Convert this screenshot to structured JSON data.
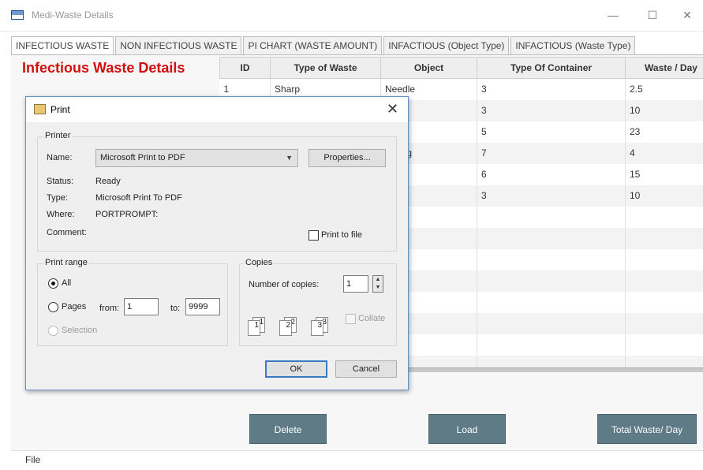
{
  "window": {
    "title": "Medi-Waste Details",
    "minimize": "—",
    "maximize": "☐",
    "close": "✕"
  },
  "tabs": [
    "INFECTIOUS WASTE",
    "NON INFECTIOUS WASTE",
    "PI CHART (WASTE AMOUNT)",
    "INFACTIOUS (Object Type)",
    "INFACTIOUS (Waste Type)"
  ],
  "section_title": "Infectious Waste Details",
  "table": {
    "headers": [
      "ID",
      "Type of Waste",
      "Object",
      "Type Of Container",
      "Waste / Day"
    ],
    "rows": [
      [
        "1",
        "Sharp",
        "Needle",
        "3",
        "2.5"
      ],
      [
        "",
        "",
        "",
        "3",
        "10"
      ],
      [
        "",
        "",
        "l",
        "5",
        "23"
      ],
      [
        "",
        "",
        "d drug",
        "7",
        "4"
      ],
      [
        "",
        "",
        "s",
        "6",
        "15"
      ],
      [
        "",
        "",
        "le",
        "3",
        "10"
      ]
    ],
    "empty_rows": 8
  },
  "buttons": {
    "delete": "Delete",
    "load": "Load",
    "total": "Total Waste/ Day"
  },
  "menu": {
    "file": "File"
  },
  "print_dialog": {
    "title": "Print",
    "close": "✕",
    "printer_group": "Printer",
    "name_label": "Name:",
    "name_value": "Microsoft Print to PDF",
    "properties": "Properties...",
    "status_label": "Status:",
    "status_value": "Ready",
    "type_label": "Type:",
    "type_value": "Microsoft Print To PDF",
    "where_label": "Where:",
    "where_value": "PORTPROMPT:",
    "comment_label": "Comment:",
    "print_to_file": "Print to file",
    "range_group": "Print range",
    "range_all": "All",
    "range_pages": "Pages",
    "from_label": "from:",
    "from_value": "1",
    "to_label": "to:",
    "to_value": "9999",
    "range_selection": "Selection",
    "copies_group": "Copies",
    "copies_label": "Number of copies:",
    "copies_value": "1",
    "collate": "Collate",
    "ok": "OK",
    "cancel": "Cancel"
  }
}
